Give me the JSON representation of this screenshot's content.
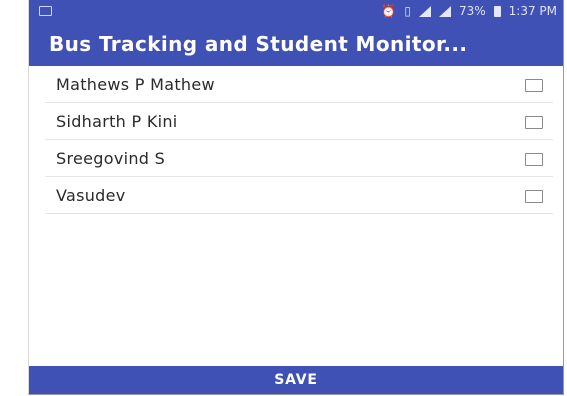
{
  "status_bar": {
    "battery": "73%",
    "time": "1:37 PM",
    "icons": [
      "notification-icon",
      "alarm-icon",
      "vibrate-icon",
      "no-sim-icon",
      "signal-icon",
      "battery-icon"
    ]
  },
  "app_bar": {
    "title": "Bus Tracking and Student Monitor..."
  },
  "students": [
    {
      "name": "Mathews P Mathew",
      "checked": false
    },
    {
      "name": "Sidharth P Kini",
      "checked": false
    },
    {
      "name": "Sreegovind S",
      "checked": false
    },
    {
      "name": "Vasudev",
      "checked": false
    }
  ],
  "actions": {
    "save_label": "SAVE"
  },
  "colors": {
    "primary": "#3f51b5",
    "text": "#2a2a2a",
    "divider": "#e6e6e6"
  }
}
